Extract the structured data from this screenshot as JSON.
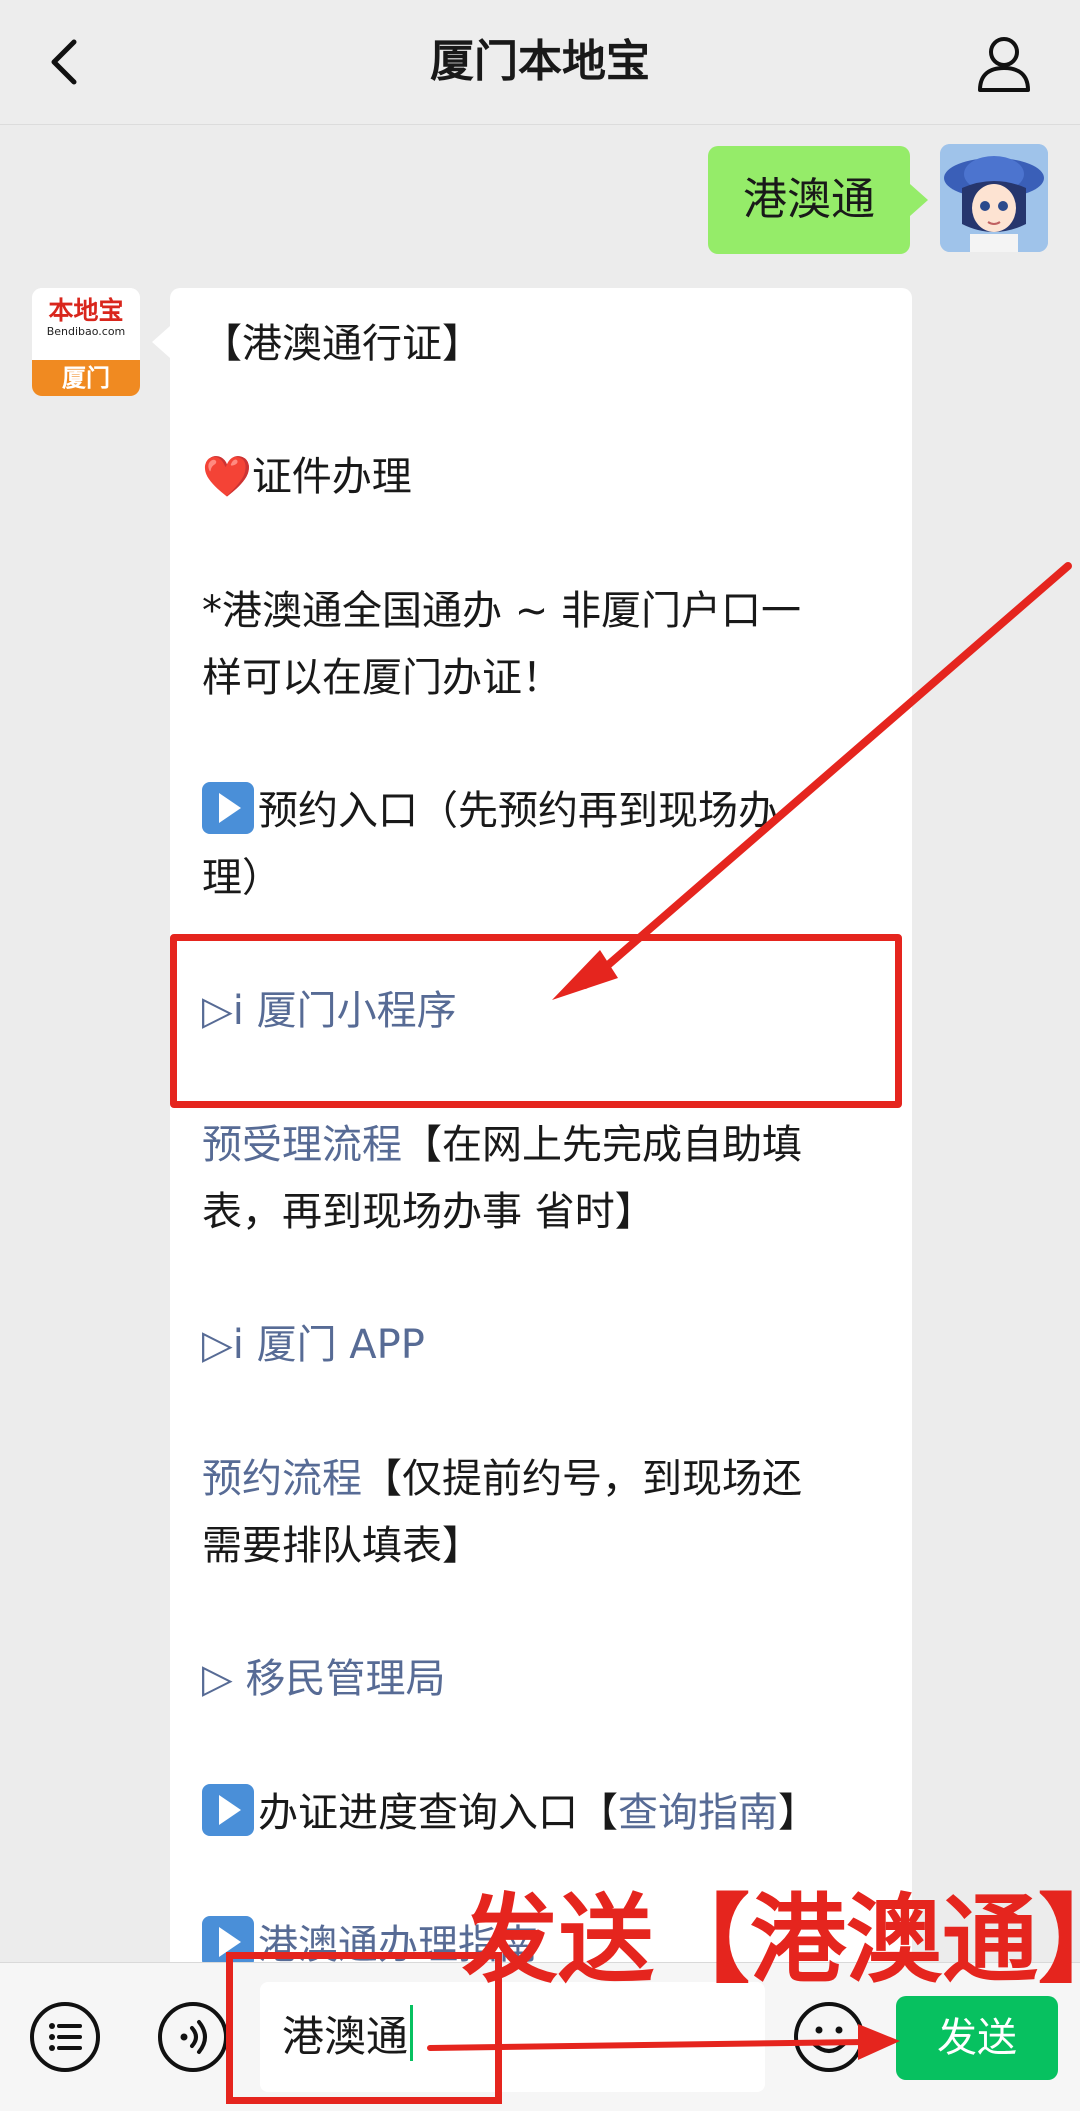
{
  "header": {
    "title": "厦门本地宝"
  },
  "me": {
    "message": "港澳通"
  },
  "account": {
    "logo_name": "本地宝",
    "logo_sub": "Bendibao.com",
    "logo_city": "厦门"
  },
  "reply": {
    "l1": "【港澳通行证】",
    "l2": "证件办理",
    "l3a": "*港澳通全国通办 ~ 非厦门户口一",
    "l3b": "样可以在厦门办证！",
    "l4a": "预约入口（先预约再到现场办",
    "l4b": "理）",
    "l5": "▷i 厦门小程序",
    "l6_link": "预受理流程",
    "l6_text": "【在网上先完成自助填",
    "l6b": "表，再到现场办事 省时】",
    "l7": "▷i 厦门 APP",
    "l8_link": "预约流程",
    "l8_text": "【仅提前约号，到现场还",
    "l8b": "需要排队填表】",
    "l9": "▷ 移民管理局",
    "l10_text1": "办证进度查询入口【",
    "l10_link": "查询指南",
    "l10_text2": "】",
    "l11": "港澳通办理指南"
  },
  "input": {
    "value": "港澳通",
    "send_label": "发送"
  },
  "annotation": {
    "text": "发送【港澳通】"
  },
  "colors": {
    "accent": "#07c160",
    "bubble_me": "#95ec69",
    "link": "#576b95",
    "annotation": "#e5251e"
  }
}
